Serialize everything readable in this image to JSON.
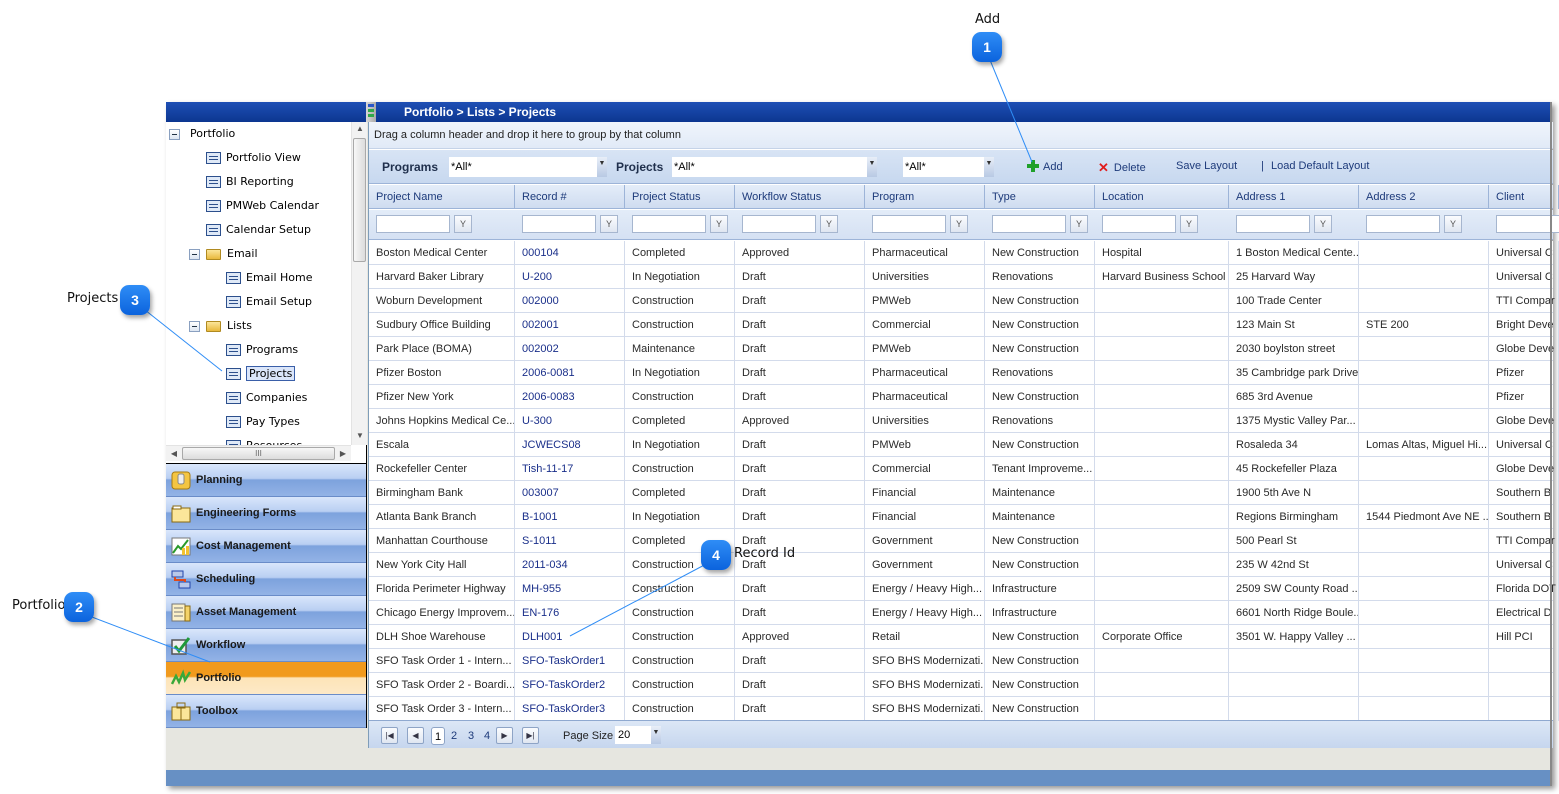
{
  "callouts": [
    {
      "number": "1",
      "label": "Add"
    },
    {
      "number": "2",
      "label": "Portfolio"
    },
    {
      "number": "3",
      "label": "Projects"
    },
    {
      "number": "4",
      "label": "Record Id"
    }
  ],
  "header": {
    "breadcrumb": "Portfolio > Lists > Projects"
  },
  "tree": {
    "items": [
      {
        "label": "Portfolio",
        "type": "root"
      },
      {
        "label": "Portfolio View",
        "type": "page"
      },
      {
        "label": "BI Reporting",
        "type": "page"
      },
      {
        "label": "PMWeb Calendar",
        "type": "page"
      },
      {
        "label": "Calendar Setup",
        "type": "page"
      },
      {
        "label": "Email",
        "type": "folder"
      },
      {
        "label": "Email Home",
        "type": "page"
      },
      {
        "label": "Email Setup",
        "type": "page"
      },
      {
        "label": "Lists",
        "type": "folder"
      },
      {
        "label": "Programs",
        "type": "page"
      },
      {
        "label": "Projects",
        "type": "page",
        "selected": true
      },
      {
        "label": "Companies",
        "type": "page"
      },
      {
        "label": "Pay Types",
        "type": "page"
      },
      {
        "label": "Resources",
        "type": "page"
      }
    ]
  },
  "modules": [
    {
      "label": "Planning",
      "icon": "planning-icon"
    },
    {
      "label": "Engineering Forms",
      "icon": "folder-icon"
    },
    {
      "label": "Cost Management",
      "icon": "chart-icon"
    },
    {
      "label": "Scheduling",
      "icon": "scheduling-icon"
    },
    {
      "label": "Asset Management",
      "icon": "asset-icon"
    },
    {
      "label": "Workflow",
      "icon": "checkbox-icon"
    },
    {
      "label": "Portfolio",
      "icon": "portfolio-icon",
      "active": true
    },
    {
      "label": "Toolbox",
      "icon": "toolbox-icon"
    }
  ],
  "grid": {
    "group_hint": "Drag a column header and drop it here to group by that column",
    "filters": {
      "programs_label": "Programs",
      "programs_value": "*All*",
      "projects_label": "Projects",
      "projects_value": "*All*",
      "third_value": "*All*"
    },
    "toolbar": {
      "add": "Add",
      "delete": "Delete",
      "save_layout": "Save Layout",
      "separator": "|",
      "load_default_layout": "Load Default Layout"
    },
    "columns": [
      "Project Name",
      "Record #",
      "Project Status",
      "Workflow Status",
      "Program",
      "Type",
      "Location",
      "Address 1",
      "Address 2",
      "Client"
    ],
    "rows": [
      [
        "Boston Medical Center",
        "000104",
        "Completed",
        "Approved",
        "Pharmaceutical",
        "New Construction",
        "Hospital",
        "1 Boston Medical Cente...",
        "",
        "Universal C"
      ],
      [
        "Harvard Baker Library",
        "U-200",
        "In Negotiation",
        "Draft",
        "Universities",
        "Renovations",
        "Harvard Business School",
        "25 Harvard Way",
        "",
        "Universal C"
      ],
      [
        "Woburn Development",
        "002000",
        "Construction",
        "Draft",
        "PMWeb",
        "New Construction",
        "",
        "100 Trade Center",
        "",
        "TTI Compar"
      ],
      [
        "Sudbury Office Building",
        "002001",
        "Construction",
        "Draft",
        "Commercial",
        "New Construction",
        "",
        "123 Main St",
        "STE 200",
        "Bright Deve"
      ],
      [
        "Park Place (BOMA)",
        "002002",
        "Maintenance",
        "Draft",
        "PMWeb",
        "New Construction",
        "",
        "2030 boylston street",
        "",
        "Globe Deve"
      ],
      [
        "Pfizer Boston",
        "2006-0081",
        "In Negotiation",
        "Draft",
        "Pharmaceutical",
        "Renovations",
        "",
        "35 Cambridge park Drive",
        "",
        "Pfizer"
      ],
      [
        "Pfizer New York",
        "2006-0083",
        "Construction",
        "Draft",
        "Pharmaceutical",
        "New Construction",
        "",
        "685 3rd Avenue",
        "",
        "Pfizer"
      ],
      [
        "Johns Hopkins Medical Ce...",
        "U-300",
        "Completed",
        "Approved",
        "Universities",
        "Renovations",
        "",
        "1375 Mystic Valley Par...",
        "",
        "Globe Deve"
      ],
      [
        "Escala",
        "JCWECS08",
        "In Negotiation",
        "Draft",
        "PMWeb",
        "New Construction",
        "",
        "Rosaleda 34",
        "Lomas Altas, Miguel Hi...",
        "Universal C"
      ],
      [
        "Rockefeller Center",
        "Tish-11-17",
        "Construction",
        "Draft",
        "Commercial",
        "Tenant Improveme...",
        "",
        "45 Rockefeller Plaza",
        "",
        "Globe Deve"
      ],
      [
        "Birmingham Bank",
        "003007",
        "Completed",
        "Draft",
        "Financial",
        "Maintenance",
        "",
        "1900 5th Ave N",
        "",
        "Southern B"
      ],
      [
        "Atlanta Bank Branch",
        "B-1001",
        "In Negotiation",
        "Draft",
        "Financial",
        "Maintenance",
        "",
        "Regions Birmingham",
        "1544 Piedmont Ave NE ...",
        "Southern B"
      ],
      [
        "Manhattan Courthouse",
        "S-1011",
        "Completed",
        "Draft",
        "Government",
        "New Construction",
        "",
        "500 Pearl St",
        "",
        "TTI Compar"
      ],
      [
        "New York City Hall",
        "2011-034",
        "Construction",
        "Draft",
        "Government",
        "New Construction",
        "",
        "235 W 42nd St",
        "",
        "Universal C"
      ],
      [
        "Florida Perimeter Highway",
        "MH-955",
        "Construction",
        "Draft",
        "Energy / Heavy High...",
        "Infrastructure",
        "",
        "2509 SW County Road ...",
        "",
        "Florida DOT"
      ],
      [
        "Chicago Energy Improvem...",
        "EN-176",
        "Construction",
        "Draft",
        "Energy / Heavy High...",
        "Infrastructure",
        "",
        "6601 North Ridge Boule...",
        "",
        "Electrical D"
      ],
      [
        "DLH Shoe Warehouse",
        "DLH001",
        "Construction",
        "Approved",
        "Retail",
        "New Construction",
        "Corporate Office",
        "3501 W. Happy Valley ...",
        "",
        "Hill PCI"
      ],
      [
        "SFO Task Order 1 - Intern...",
        "SFO-TaskOrder1",
        "Construction",
        "Draft",
        "SFO BHS Modernizati...",
        "New Construction",
        "",
        "",
        "",
        ""
      ],
      [
        "SFO Task Order 2 - Boardi...",
        "SFO-TaskOrder2",
        "Construction",
        "Draft",
        "SFO BHS Modernizati...",
        "New Construction",
        "",
        "",
        "",
        ""
      ],
      [
        "SFO Task Order 3 - Intern...",
        "SFO-TaskOrder3",
        "Construction",
        "Draft",
        "SFO BHS Modernizati...",
        "New Construction",
        "",
        "",
        "",
        ""
      ]
    ]
  },
  "pager": {
    "pages": [
      "1",
      "2",
      "3",
      "4"
    ],
    "current_page": "1",
    "page_size_label": "Page Size",
    "page_size": "20"
  },
  "colors": {
    "header_blue": "#0c3690",
    "active_module": "#f19a1d",
    "link_blue": "#1a2f8a",
    "callout_blue": "#0b63dd"
  }
}
